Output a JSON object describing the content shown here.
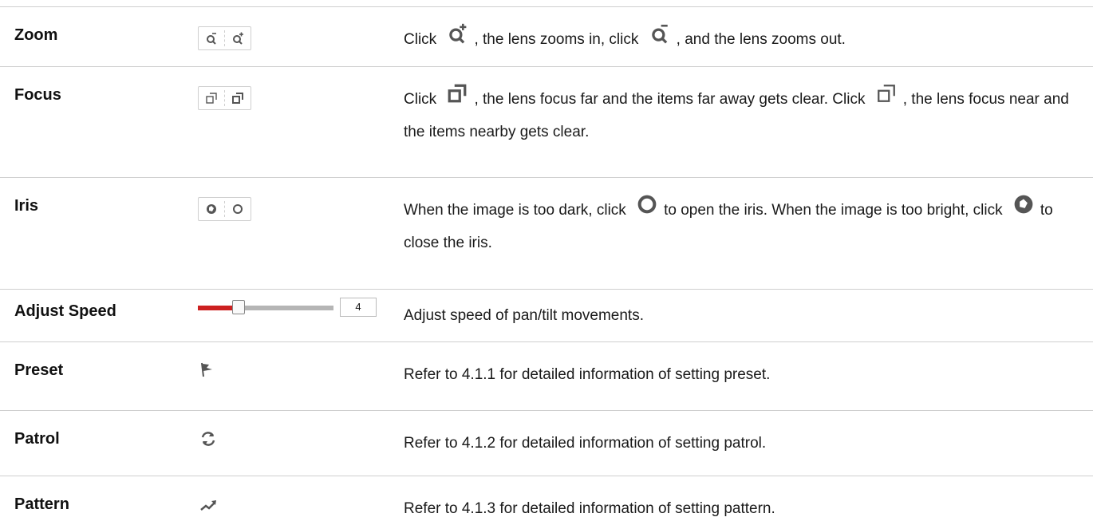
{
  "rows": [
    {
      "name": "Zoom",
      "controls": [
        "zoom-out-icon",
        "zoom-in-icon"
      ],
      "desc": {
        "p1": "Click",
        "p2": ", the lens zooms in, click",
        "p3": ", and the lens zooms out."
      }
    },
    {
      "name": "Focus",
      "controls": [
        "focus-near-icon",
        "focus-far-icon"
      ],
      "desc": {
        "p1": "Click",
        "p2": ", the lens focus far and the items far away gets clear. Click",
        "p3": ", the lens focus near and the items nearby gets clear."
      }
    },
    {
      "name": "Iris",
      "controls": [
        "iris-close-icon",
        "iris-open-icon"
      ],
      "desc": {
        "p1": "When the image is too dark, click",
        "p2": "to open the iris. When the image is too bright, click",
        "p3": "to close the iris."
      }
    },
    {
      "name": "Adjust Speed",
      "slider": {
        "value": "4",
        "level_fraction": 0.3
      },
      "desc": {
        "text": "Adjust speed of pan/tilt movements."
      }
    },
    {
      "name": "Preset",
      "icon": "flag-icon",
      "desc": {
        "text": "Refer to 4.1.1 for detailed information of setting preset."
      }
    },
    {
      "name": "Patrol",
      "icon": "refresh-icon",
      "desc": {
        "text": "Refer to 4.1.2 for detailed information of setting patrol."
      }
    },
    {
      "name": "Pattern",
      "icon": "trend-icon",
      "desc": {
        "text": "Refer to 4.1.3 for detailed information of setting pattern."
      }
    }
  ],
  "colors": {
    "slider_fill": "#cc2020",
    "slider_track": "#b5b5b5",
    "divider": "#cfcfcf",
    "icon": "#555555"
  }
}
